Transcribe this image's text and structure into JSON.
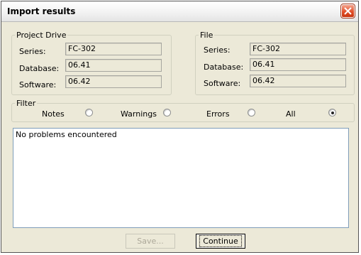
{
  "window": {
    "title": "Import results"
  },
  "project_drive": {
    "legend": "Project Drive",
    "series_label": "Series:",
    "series_value": "FC-302",
    "database_label": "Database:",
    "database_value": "06.41",
    "software_label": "Software:",
    "software_value": "06.42"
  },
  "file": {
    "legend": "File",
    "series_label": "Series:",
    "series_value": "FC-302",
    "database_label": "Database:",
    "database_value": "06.41",
    "software_label": "Software:",
    "software_value": "06.42"
  },
  "filter": {
    "legend": "Filter",
    "options": [
      {
        "label": "Notes",
        "selected": false
      },
      {
        "label": "Warnings",
        "selected": false
      },
      {
        "label": "Errors",
        "selected": false
      },
      {
        "label": "All",
        "selected": true
      }
    ]
  },
  "results": {
    "text": "No problems encountered"
  },
  "buttons": {
    "save": "Save...",
    "continue": "Continue"
  }
}
